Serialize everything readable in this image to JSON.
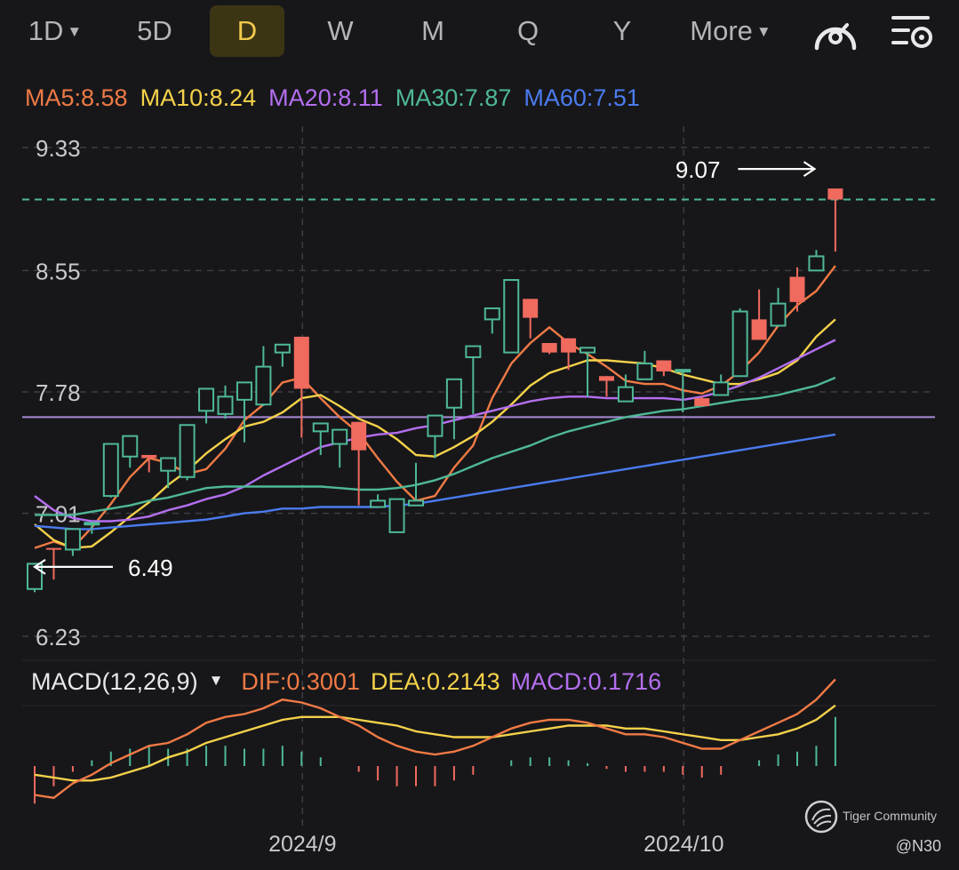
{
  "toolbar": {
    "tabs": [
      {
        "label": "1D",
        "caret": true,
        "active": false
      },
      {
        "label": "5D",
        "caret": false,
        "active": false
      },
      {
        "label": "D",
        "caret": false,
        "active": true
      },
      {
        "label": "W",
        "caret": false,
        "active": false
      },
      {
        "label": "M",
        "caret": false,
        "active": false
      },
      {
        "label": "Q",
        "caret": false,
        "active": false
      },
      {
        "label": "Y",
        "caret": false,
        "active": false
      },
      {
        "label": "More",
        "caret": true,
        "active": false
      }
    ],
    "icons": [
      "gauge-icon",
      "indicator-settings-icon"
    ]
  },
  "ma_legend": [
    {
      "label": "MA5:8.58",
      "color": "#f07a45"
    },
    {
      "label": "MA10:8.24",
      "color": "#f5d24a"
    },
    {
      "label": "MA20:8.11",
      "color": "#b46ff0"
    },
    {
      "label": "MA30:7.87",
      "color": "#4fb896"
    },
    {
      "label": "MA60:7.51",
      "color": "#4b7bef"
    }
  ],
  "macd_legend": {
    "title": "MACD(12,26,9)",
    "items": [
      {
        "label": "DIF:0.3001",
        "color": "#f07a45"
      },
      {
        "label": "DEA:0.2143",
        "color": "#f5d24a"
      },
      {
        "label": "MACD:0.1716",
        "color": "#b46ff0"
      }
    ]
  },
  "watermark": "Tiger Community",
  "credit": "@N30",
  "chart_data": {
    "type": "candlestick",
    "y_ticks": [
      "9.33",
      "8.55",
      "7.78",
      "7.01",
      "6.23"
    ],
    "ylim": [
      6.23,
      9.33
    ],
    "x_ticks": [
      {
        "label": "2024/9",
        "index": 14
      },
      {
        "label": "2024/10",
        "index": 34
      }
    ],
    "annotations": {
      "high": {
        "label": "9.07",
        "value": 9.07,
        "index": 41
      },
      "low": {
        "label": "6.49",
        "value": 6.49,
        "index": 0
      }
    },
    "reference_lines": {
      "last_price": 9.0,
      "support": 7.62
    },
    "up_color": "#4fb896",
    "down_color": "#f06a5e",
    "candles": [
      [
        6.53,
        6.69,
        6.51,
        6.68
      ],
      [
        6.79,
        6.78,
        6.59,
        6.6
      ],
      [
        6.78,
        6.91,
        6.74,
        6.89
      ],
      [
        6.94,
        6.95,
        6.88,
        6.9
      ],
      [
        7.12,
        7.45,
        7.11,
        7.44
      ],
      [
        7.37,
        7.5,
        7.3,
        7.36
      ],
      [
        7.38,
        7.36,
        7.27,
        7.28
      ],
      [
        7.28,
        7.36,
        7.17,
        7.24
      ],
      [
        7.24,
        7.57,
        7.22,
        7.54
      ],
      [
        7.66,
        7.8,
        7.58,
        7.72
      ],
      [
        7.64,
        7.75,
        7.61,
        7.82
      ],
      [
        7.73,
        7.84,
        7.54,
        7.46
      ],
      [
        7.7,
        7.94,
        7.69,
        8.07
      ],
      [
        8.03,
        8.08,
        7.95,
        7.94
      ],
      [
        8.13,
        7.8,
        7.72,
        7.49
      ],
      [
        7.53,
        7.58,
        7.41,
        7.38
      ],
      [
        7.45,
        7.54,
        7.41,
        7.3
      ],
      [
        7.59,
        7.41,
        7.25,
        7.06
      ],
      [
        7.05,
        7.09,
        7.13,
        7.05
      ],
      [
        6.89,
        7.1,
        7.03,
        7.06
      ],
      [
        7.06,
        7.09,
        7.33,
        7.25
      ],
      [
        7.5,
        7.63,
        7.36,
        7.48
      ],
      [
        7.68,
        7.86,
        7.69,
        7.48
      ],
      [
        8.0,
        8.07,
        7.64,
        7.71
      ],
      [
        8.24,
        8.31,
        8.19,
        8.15
      ],
      [
        8.03,
        8.49,
        8.03,
        8.06
      ],
      [
        8.37,
        8.25,
        8.12,
        8.18
      ],
      [
        8.09,
        8.03,
        8.02,
        8.06
      ],
      [
        8.12,
        8.03,
        8.0,
        7.92
      ],
      [
        8.03,
        8.06,
        7.87,
        7.75
      ],
      [
        7.88,
        7.85,
        7.85,
        7.75
      ],
      [
        7.72,
        7.81,
        7.89,
        7.8
      ],
      [
        7.86,
        7.96,
        8.04,
        7.86
      ],
      [
        7.98,
        7.91,
        7.88,
        7.89
      ],
      [
        7.92,
        7.92,
        7.75,
        7.65
      ],
      [
        7.74,
        7.69,
        7.75,
        7.73
      ],
      [
        7.76,
        7.84,
        7.89,
        7.81
      ],
      [
        7.88,
        8.29,
        8.31,
        7.94
      ],
      [
        8.24,
        8.11,
        8.43,
        8.18
      ],
      [
        8.2,
        8.34,
        8.44,
        8.21
      ],
      [
        8.51,
        8.35,
        8.57,
        8.29
      ],
      [
        8.55,
        8.64,
        8.68,
        8.55
      ],
      [
        9.07,
        9.0,
        9.07,
        8.67
      ]
    ],
    "series": [
      {
        "name": "MA5",
        "color": "#f07a45",
        "values": [
          6.79,
          6.83,
          6.79,
          6.92,
          7.07,
          7.24,
          7.36,
          7.33,
          7.26,
          7.29,
          7.42,
          7.6,
          7.7,
          7.84,
          7.87,
          7.74,
          7.62,
          7.52,
          7.36,
          7.21,
          7.09,
          7.12,
          7.3,
          7.44,
          7.74,
          7.96,
          8.09,
          8.19,
          8.09,
          8.02,
          7.94,
          7.85,
          7.83,
          7.83,
          7.79,
          7.77,
          7.82,
          7.91,
          8.03,
          8.2,
          8.33,
          8.42,
          8.58
        ]
      },
      {
        "name": "MA10",
        "color": "#f5d24a",
        "values": [
          6.94,
          6.84,
          6.79,
          6.8,
          6.89,
          6.99,
          7.08,
          7.19,
          7.28,
          7.39,
          7.48,
          7.56,
          7.59,
          7.65,
          7.74,
          7.76,
          7.69,
          7.61,
          7.56,
          7.48,
          7.38,
          7.37,
          7.43,
          7.5,
          7.59,
          7.7,
          7.82,
          7.9,
          7.94,
          7.98,
          7.98,
          7.97,
          7.96,
          7.93,
          7.89,
          7.86,
          7.83,
          7.83,
          7.86,
          7.9,
          7.98,
          8.13,
          8.24
        ]
      },
      {
        "name": "MA20",
        "color": "#b46ff0",
        "values": [
          7.12,
          7.03,
          6.98,
          6.96,
          6.96,
          6.97,
          6.99,
          7.03,
          7.06,
          7.1,
          7.13,
          7.18,
          7.25,
          7.31,
          7.37,
          7.43,
          7.46,
          7.49,
          7.51,
          7.52,
          7.55,
          7.57,
          7.6,
          7.63,
          7.66,
          7.69,
          7.72,
          7.74,
          7.75,
          7.75,
          7.74,
          7.74,
          7.74,
          7.74,
          7.73,
          7.75,
          7.78,
          7.82,
          7.87,
          7.93,
          7.99,
          8.05,
          8.11
        ]
      },
      {
        "name": "MA30",
        "color": "#4fb896",
        "values": [
          7.0,
          7.0,
          7.0,
          7.02,
          7.04,
          7.06,
          7.09,
          7.11,
          7.14,
          7.17,
          7.18,
          7.18,
          7.18,
          7.18,
          7.18,
          7.18,
          7.17,
          7.16,
          7.16,
          7.17,
          7.19,
          7.22,
          7.26,
          7.31,
          7.36,
          7.4,
          7.44,
          7.49,
          7.53,
          7.56,
          7.59,
          7.62,
          7.64,
          7.66,
          7.67,
          7.69,
          7.71,
          7.73,
          7.74,
          7.76,
          7.79,
          7.82,
          7.87
        ]
      },
      {
        "name": "MA60",
        "color": "#4b7bef",
        "values": [
          6.93,
          6.92,
          6.91,
          6.91,
          6.92,
          6.93,
          6.94,
          6.95,
          6.96,
          6.97,
          6.99,
          7.01,
          7.02,
          7.04,
          7.04,
          7.05,
          7.05,
          7.05,
          7.05,
          7.06,
          7.07,
          7.09,
          7.11,
          7.13,
          7.15,
          7.17,
          7.19,
          7.21,
          7.23,
          7.25,
          7.27,
          7.29,
          7.31,
          7.33,
          7.35,
          7.37,
          7.39,
          7.41,
          7.43,
          7.45,
          7.47,
          7.49,
          7.51
        ]
      }
    ],
    "macd": {
      "dif": [
        -0.1,
        -0.11,
        -0.06,
        -0.03,
        0.01,
        0.04,
        0.07,
        0.08,
        0.11,
        0.15,
        0.17,
        0.18,
        0.2,
        0.23,
        0.22,
        0.2,
        0.17,
        0.14,
        0.1,
        0.07,
        0.05,
        0.04,
        0.05,
        0.07,
        0.1,
        0.13,
        0.15,
        0.16,
        0.16,
        0.15,
        0.13,
        0.11,
        0.11,
        0.1,
        0.08,
        0.06,
        0.06,
        0.09,
        0.12,
        0.15,
        0.18,
        0.23,
        0.3
      ],
      "dea": [
        -0.03,
        -0.04,
        -0.05,
        -0.05,
        -0.04,
        -0.02,
        0.0,
        0.03,
        0.05,
        0.08,
        0.1,
        0.12,
        0.14,
        0.16,
        0.17,
        0.17,
        0.17,
        0.16,
        0.15,
        0.14,
        0.12,
        0.11,
        0.1,
        0.1,
        0.1,
        0.11,
        0.12,
        0.13,
        0.14,
        0.14,
        0.14,
        0.13,
        0.13,
        0.12,
        0.11,
        0.1,
        0.09,
        0.09,
        0.1,
        0.11,
        0.13,
        0.16,
        0.21
      ],
      "hist": [
        -0.13,
        -0.07,
        -0.02,
        0.02,
        0.05,
        0.06,
        0.07,
        0.06,
        0.06,
        0.07,
        0.07,
        0.06,
        0.06,
        0.07,
        0.05,
        0.03,
        0.0,
        -0.02,
        -0.05,
        -0.07,
        -0.07,
        -0.07,
        -0.05,
        -0.03,
        0.0,
        0.02,
        0.03,
        0.03,
        0.02,
        0.01,
        -0.01,
        -0.02,
        -0.02,
        -0.02,
        -0.03,
        -0.04,
        -0.03,
        0.0,
        0.02,
        0.04,
        0.05,
        0.07,
        0.17
      ]
    }
  }
}
